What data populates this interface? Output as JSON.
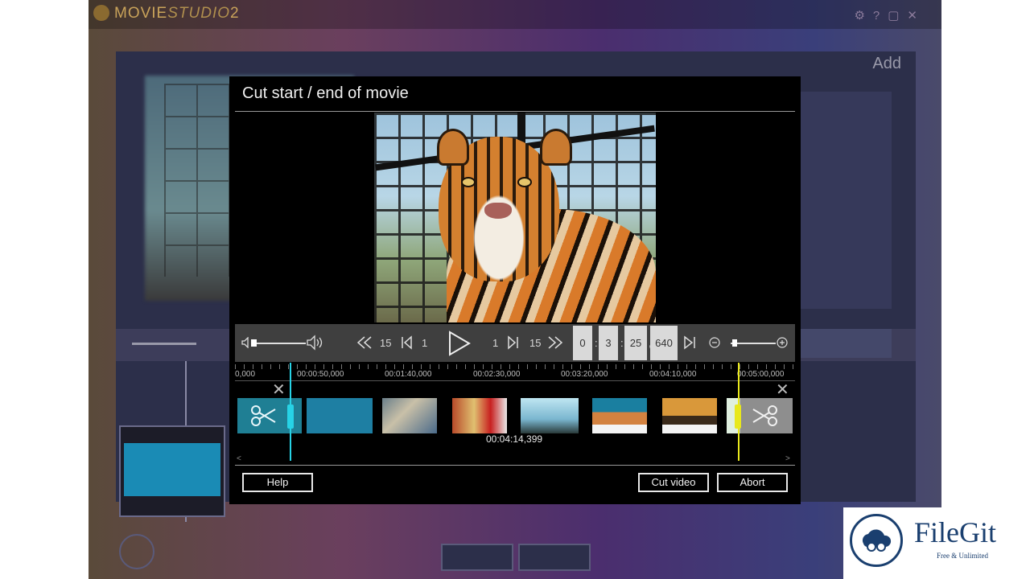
{
  "background_app": {
    "brand_movie": "MOVIE",
    "brand_studio": "STUDIO",
    "brand_version": "2",
    "add_label": "Add"
  },
  "dialog": {
    "title": "Cut start / end of movie",
    "controls": {
      "rewind_15_label": "15",
      "rewind_1_label": "1",
      "forward_1_label": "1",
      "forward_15_label": "15",
      "timecode": {
        "hours": "0",
        "minutes": "3",
        "seconds": "25",
        "milliseconds": "640"
      }
    },
    "ruler_labels": [
      "0,000",
      "00:00:50,000",
      "00:01:40,000",
      "00:02:30,000",
      "00:03:20,000",
      "00:04:10,000",
      "00:05:00,000"
    ],
    "cursor_time": "00:04:14,399",
    "buttons": {
      "help": "Help",
      "cut_video": "Cut video",
      "abort": "Abort"
    }
  },
  "watermark": {
    "name": "FileGit",
    "tagline": "Free & Unlimited"
  },
  "colors": {
    "start_marker": "#27d3e6",
    "end_marker": "#e8e81c",
    "dialog_bg": "#000000",
    "control_bar": "#3f3f3f"
  }
}
